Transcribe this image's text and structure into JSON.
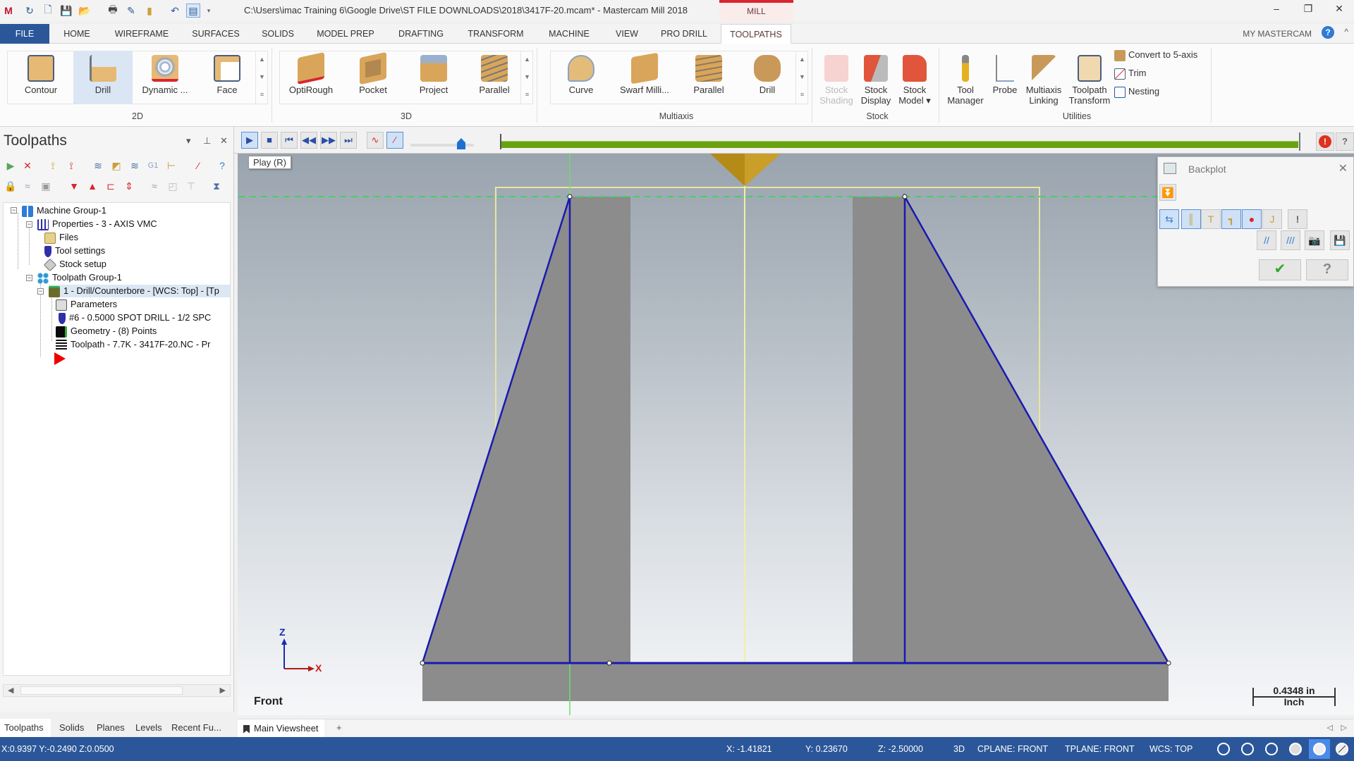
{
  "titlebar": {
    "title": "C:\\Users\\imac Training 6\\Google Drive\\ST FILE DOWNLOADS\\2018\\3417F-20.mcam* - Mastercam Mill 2018",
    "context_tab": "MILL",
    "minimize": "–",
    "restore": "❐",
    "close": "✕"
  },
  "ribbon_tabs": [
    "FILE",
    "HOME",
    "WIREFRAME",
    "SURFACES",
    "SOLIDS",
    "MODEL PREP",
    "DRAFTING",
    "TRANSFORM",
    "MACHINE",
    "VIEW",
    "PRO DRILL",
    "TOOLPATHS"
  ],
  "ribbon_right": {
    "my_mastercam": "MY MASTERCAM",
    "help": "?",
    "collapse": "^"
  },
  "ribbon": {
    "groups": {
      "g2d": "2D",
      "g3d": "3D",
      "multiaxis": "Multiaxis",
      "stock": "Stock",
      "utilities": "Utilities"
    },
    "buttons_2d": [
      "Contour",
      "Drill",
      "Dynamic ...",
      "Face"
    ],
    "buttons_3d": [
      "OptiRough",
      "Pocket",
      "Project",
      "Parallel"
    ],
    "buttons_multiaxis": [
      "Curve",
      "Swarf Milli...",
      "Parallel",
      "Drill"
    ],
    "stock_shading": [
      "Stock",
      "Shading"
    ],
    "stock_display": [
      "Stock",
      "Display"
    ],
    "stock_model": [
      "Stock",
      "Model ▾"
    ],
    "tool_manager": [
      "Tool",
      "Manager"
    ],
    "probe": "Probe",
    "multiaxis_linking": [
      "Multiaxis",
      "Linking"
    ],
    "toolpath_transform": [
      "Toolpath",
      "Transform"
    ],
    "convert_5axis": "Convert to 5-axis",
    "trim": "Trim",
    "nesting": "Nesting"
  },
  "toolpaths_panel": {
    "title": "Toolpaths",
    "tree": {
      "machine_group": "Machine Group-1",
      "properties": "Properties - 3 - AXIS VMC",
      "files": "Files",
      "tool_settings": "Tool settings",
      "stock_setup": "Stock setup",
      "toolpath_group": "Toolpath Group-1",
      "operation": "1 - Drill/Counterbore - [WCS: Top] - [Tp",
      "parameters": "Parameters",
      "tool": "#6 - 0.5000 SPOT DRILL - 1/2 SPC",
      "geometry": "Geometry - (8) Points",
      "toolpath": "Toolpath - 7.7K - 3417F-20.NC - Pr"
    },
    "bottom_tabs": [
      "Toolpaths",
      "Solids",
      "Planes",
      "Levels",
      "Recent Fu..."
    ]
  },
  "playback": {
    "tooltip": "Play (R)",
    "speed_fraction": 0.8,
    "progress_fraction": 1.0
  },
  "backplot": {
    "title": "Backplot",
    "close": "✕",
    "ok": "✔",
    "help": "?"
  },
  "viewport": {
    "view_name": "Front",
    "axis_z": "Z",
    "axis_x": "X",
    "scale_value": "0.4348 in",
    "scale_unit": "Inch"
  },
  "viewsheet": {
    "tab": "Main Viewsheet",
    "add": "+"
  },
  "status": {
    "cursor": "X:0.9397   Y:-0.2490   Z:0.0500",
    "x": "X:   -1.41821",
    "y": "Y:   0.23670",
    "z": "Z:   -2.50000",
    "mode": "3D",
    "cplane": "CPLANE: FRONT",
    "tplane": "TPLANE: FRONT",
    "wcs": "WCS: TOP"
  },
  "colors": {
    "accent": "#2b579a",
    "mill_context": "#d9262e",
    "progress": "#6aa30f",
    "geometry_line": "#1a1ab0",
    "part": "#8c8c8c",
    "tool": "#b58a17"
  }
}
